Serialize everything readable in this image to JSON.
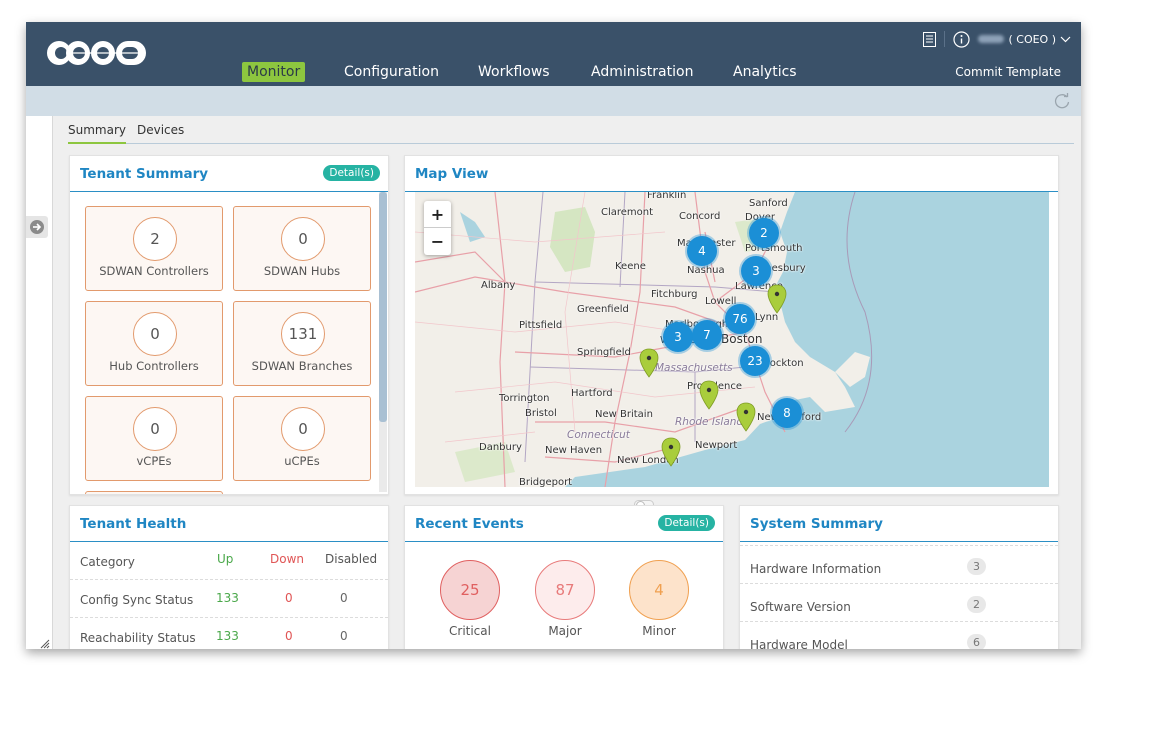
{
  "header": {
    "brand": "COEO",
    "nav": [
      {
        "label": "Monitor",
        "active": true
      },
      {
        "label": "Configuration",
        "active": false
      },
      {
        "label": "Workflows",
        "active": false
      },
      {
        "label": "Administration",
        "active": false
      },
      {
        "label": "Analytics",
        "active": false
      }
    ],
    "commit_label": "Commit Template",
    "user_org": "( COEO )",
    "icons": [
      "task-list-icon",
      "info-icon",
      "chevron-down-icon"
    ]
  },
  "subbar": {
    "refresh_icon": "refresh-icon"
  },
  "tabs": [
    {
      "label": "Summary",
      "active": true
    },
    {
      "label": "Devices",
      "active": false
    }
  ],
  "tenant_summary": {
    "title": "Tenant Summary",
    "details_label": "Detail(s)",
    "tiles": [
      {
        "count": "2",
        "label": "SDWAN Controllers"
      },
      {
        "count": "0",
        "label": "SDWAN Hubs"
      },
      {
        "count": "0",
        "label": "Hub Controllers"
      },
      {
        "count": "131",
        "label": "SDWAN Branches"
      },
      {
        "count": "0",
        "label": "vCPEs"
      },
      {
        "count": "0",
        "label": "uCPEs"
      }
    ]
  },
  "map_view": {
    "title": "Map View",
    "zoom_in": "+",
    "zoom_out": "−",
    "clusters": [
      "2",
      "4",
      "3",
      "76",
      "3",
      "7",
      "23",
      "8"
    ],
    "pins": 5,
    "places": [
      "Franklin",
      "Sanford",
      "Claremont",
      "Concord",
      "Dover",
      "Manchester",
      "Portsmouth",
      "Keene",
      "Nashua",
      "Amesbury",
      "Albany",
      "Fitchburg",
      "Lowell",
      "Lawrence",
      "Greenfield",
      "Lynn",
      "Pittsfield",
      "Marlborough",
      "Boston",
      "Worcester",
      "Springfield",
      "Brockton",
      "Massachusetts",
      "Providence",
      "Torrington",
      "Hartford",
      "Bristol",
      "New Britain",
      "New Bedford",
      "Rhode Island",
      "Connecticut",
      "Danbury",
      "New Haven",
      "Newport",
      "New London",
      "Bridgeport"
    ]
  },
  "tenant_health": {
    "title": "Tenant Health",
    "columns": [
      "Category",
      "Up",
      "Down",
      "Disabled"
    ],
    "rows": [
      {
        "category": "Config Sync Status",
        "up": "133",
        "down": "0",
        "disabled": "0"
      },
      {
        "category": "Reachability Status",
        "up": "133",
        "down": "0",
        "disabled": "0"
      }
    ]
  },
  "recent_events": {
    "title": "Recent Events",
    "details_label": "Detail(s)",
    "items": [
      {
        "count": "25",
        "label": "Critical",
        "color": "#e06060"
      },
      {
        "count": "87",
        "label": "Major",
        "color": "#e87a7a"
      },
      {
        "count": "4",
        "label": "Minor",
        "color": "#f0a050"
      }
    ]
  },
  "system_summary": {
    "title": "System Summary",
    "rows": [
      {
        "label": "Hardware Information",
        "value": "3"
      },
      {
        "label": "Software Version",
        "value": "2"
      },
      {
        "label": "Hardware Model",
        "value": "6"
      }
    ]
  }
}
